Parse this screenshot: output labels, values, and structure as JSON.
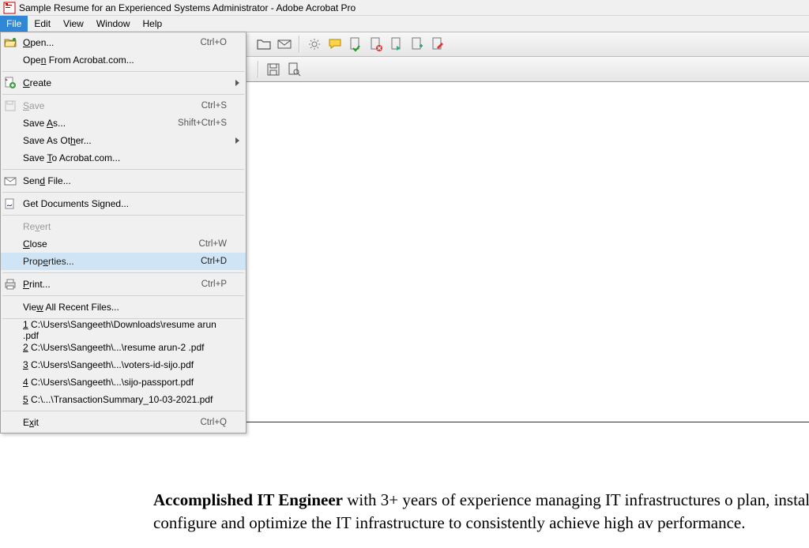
{
  "window": {
    "title": "Sample Resume for an Experienced Systems Administrator - Adobe Acrobat Pro"
  },
  "menubar": {
    "items": [
      "File",
      "Edit",
      "View",
      "Window",
      "Help"
    ],
    "active_index": 0
  },
  "file_menu": {
    "open": "Open...",
    "open_accel": "Ctrl+O",
    "open_from": "Open From Acrobat.com...",
    "create": "Create",
    "save": "Save",
    "save_accel": "Ctrl+S",
    "save_as": "Save As...",
    "save_as_accel": "Shift+Ctrl+S",
    "save_as_other": "Save As Other...",
    "save_to": "Save To Acrobat.com...",
    "send_file": "Send File...",
    "get_signed": "Get Documents Signed...",
    "revert": "Revert",
    "close": "Close",
    "close_accel": "Ctrl+W",
    "properties": "Properties...",
    "properties_accel": "Ctrl+D",
    "print": "Print...",
    "print_accel": "Ctrl+P",
    "view_recent": "View All Recent Files...",
    "recent": [
      "1 C:\\Users\\Sangeeth\\Downloads\\resume arun .pdf",
      "2 C:\\Users\\Sangeeth\\...\\resume arun-2 .pdf",
      "3 C:\\Users\\Sangeeth\\...\\voters-id-sijo.pdf",
      "4 C:\\Users\\Sangeeth\\...\\sijo-passport.pdf",
      "5 C:\\...\\TransactionSummary_10-03-2021.pdf"
    ],
    "exit": "Exit",
    "exit_accel": "Ctrl+Q"
  },
  "document": {
    "heading": "Accomplished IT Engineer",
    "body": " with  3+ years of experience managing IT infrastructures o plan, install, configure and optimize the IT infrastructure to consistently achieve high av performance."
  }
}
